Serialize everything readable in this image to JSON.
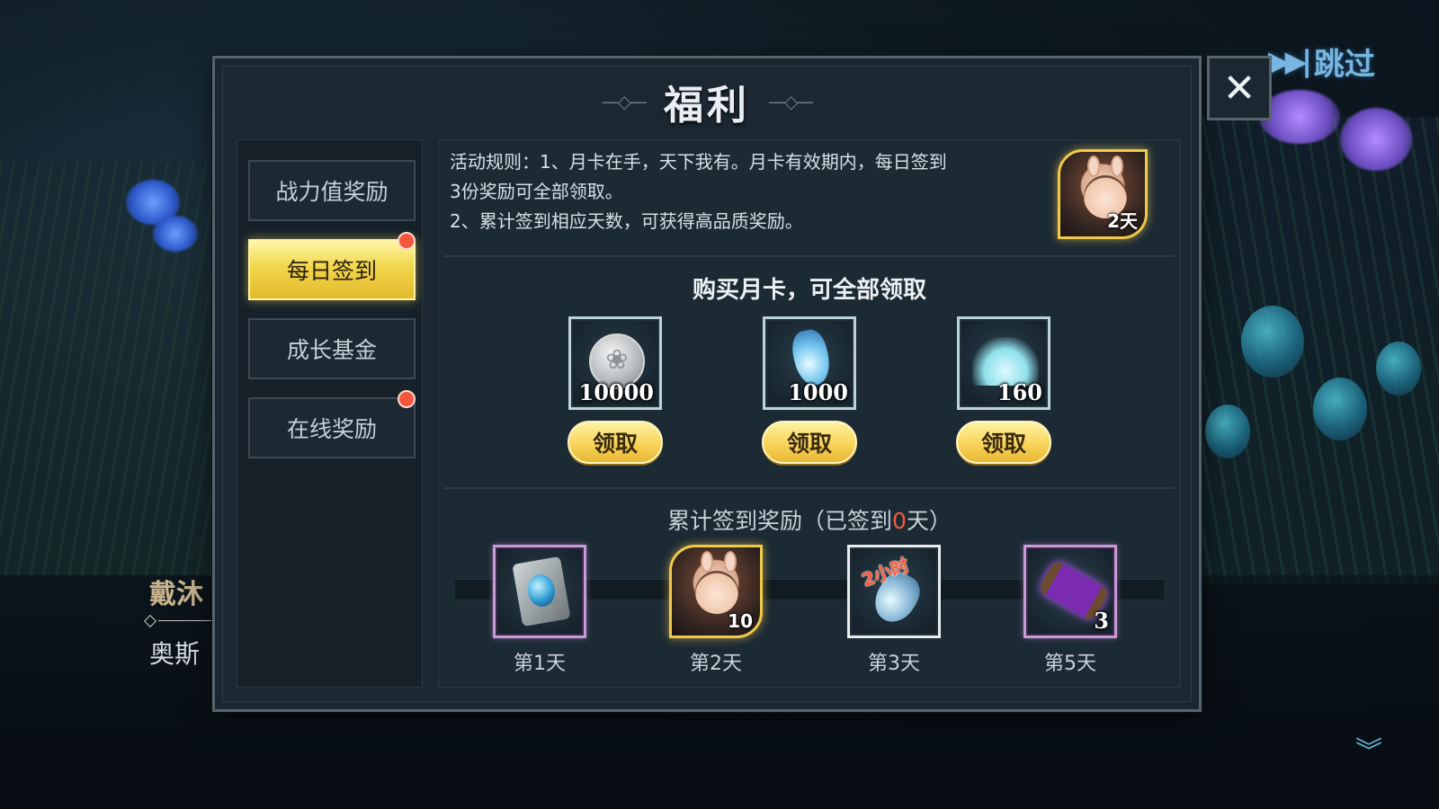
{
  "background": {
    "side_name": "戴沐",
    "side_sub": "奥斯",
    "skip_label": "跳过"
  },
  "modal": {
    "title": "福利",
    "close_icon": "close-icon",
    "nav": [
      {
        "label": "战力值奖励",
        "active": false,
        "badge": false
      },
      {
        "label": "每日签到",
        "active": true,
        "badge": true
      },
      {
        "label": "成长基金",
        "active": false,
        "badge": false
      },
      {
        "label": "在线奖励",
        "active": false,
        "badge": true
      }
    ],
    "rules": {
      "line1": "活动规则：1、月卡在手，天下我有。月卡有效期内，每日签到",
      "line2": "3份奖励可全部领取。",
      "line3": "2、累计签到相应天数，可获得高品质奖励。",
      "portrait_label": "2天"
    },
    "monthly": {
      "title": "购买月卡，可全部领取",
      "items": [
        {
          "icon": "silver-coin-icon",
          "count": "10000",
          "button": "领取"
        },
        {
          "icon": "blue-potion-icon",
          "count": "1000",
          "button": "领取"
        },
        {
          "icon": "crystal-dust-icon",
          "count": "160",
          "button": "领取"
        }
      ]
    },
    "cumulative": {
      "title_prefix": "累计签到奖励（已签到",
      "days_signed": "0",
      "title_suffix": "天）",
      "rewards": [
        {
          "icon": "gem-frame-icon",
          "count": "",
          "day": "第1天"
        },
        {
          "icon": "character-portrait-icon",
          "count": "10",
          "day": "第2天"
        },
        {
          "icon": "time-vial-icon",
          "tag": "2小时",
          "count": "",
          "day": "第3天"
        },
        {
          "icon": "purple-scroll-icon",
          "count": "3",
          "day": "第5天"
        }
      ]
    }
  },
  "colors": {
    "accent_gold": "#f1d64b",
    "badge_red": "#f2563c",
    "highlight_red": "#f25a3c",
    "panel_bg": "#1b2731"
  }
}
